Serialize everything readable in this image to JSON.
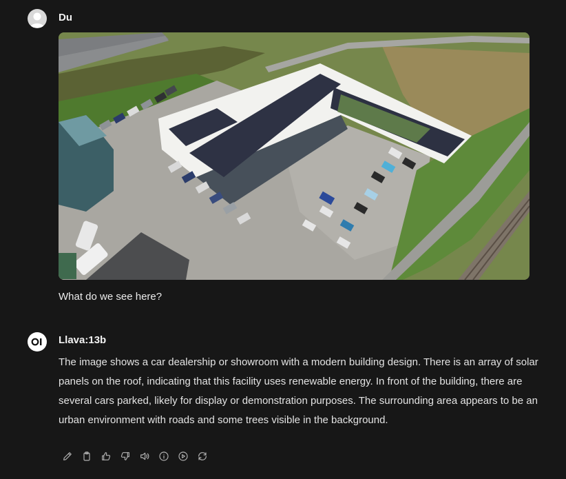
{
  "user_message": {
    "sender": "Du",
    "text": "What do we see here?",
    "image_alt": "aerial photo of a car dealership with solar panels on the roof"
  },
  "bot_message": {
    "sender": "Llava:13b",
    "text": "The image shows a car dealership or showroom with a modern building design. There is an array of solar panels on the roof, indicating that this facility uses renewable energy. In front of the building, there are several cars parked, likely for display or demonstration purposes. The surrounding area appears to be an urban environment with roads and some trees visible in the background.",
    "actions": [
      {
        "name": "edit",
        "icon": "pencil-icon"
      },
      {
        "name": "copy",
        "icon": "clipboard-icon"
      },
      {
        "name": "good-response",
        "icon": "thumbs-up-icon"
      },
      {
        "name": "bad-response",
        "icon": "thumbs-down-icon"
      },
      {
        "name": "read-aloud",
        "icon": "speaker-icon"
      },
      {
        "name": "generation-info",
        "icon": "info-icon"
      },
      {
        "name": "continue-response",
        "icon": "play-circle-icon"
      },
      {
        "name": "regenerate",
        "icon": "refresh-icon"
      }
    ]
  },
  "colors": {
    "background": "#171717",
    "text": "#ececec",
    "icon": "#b4b4b4"
  }
}
